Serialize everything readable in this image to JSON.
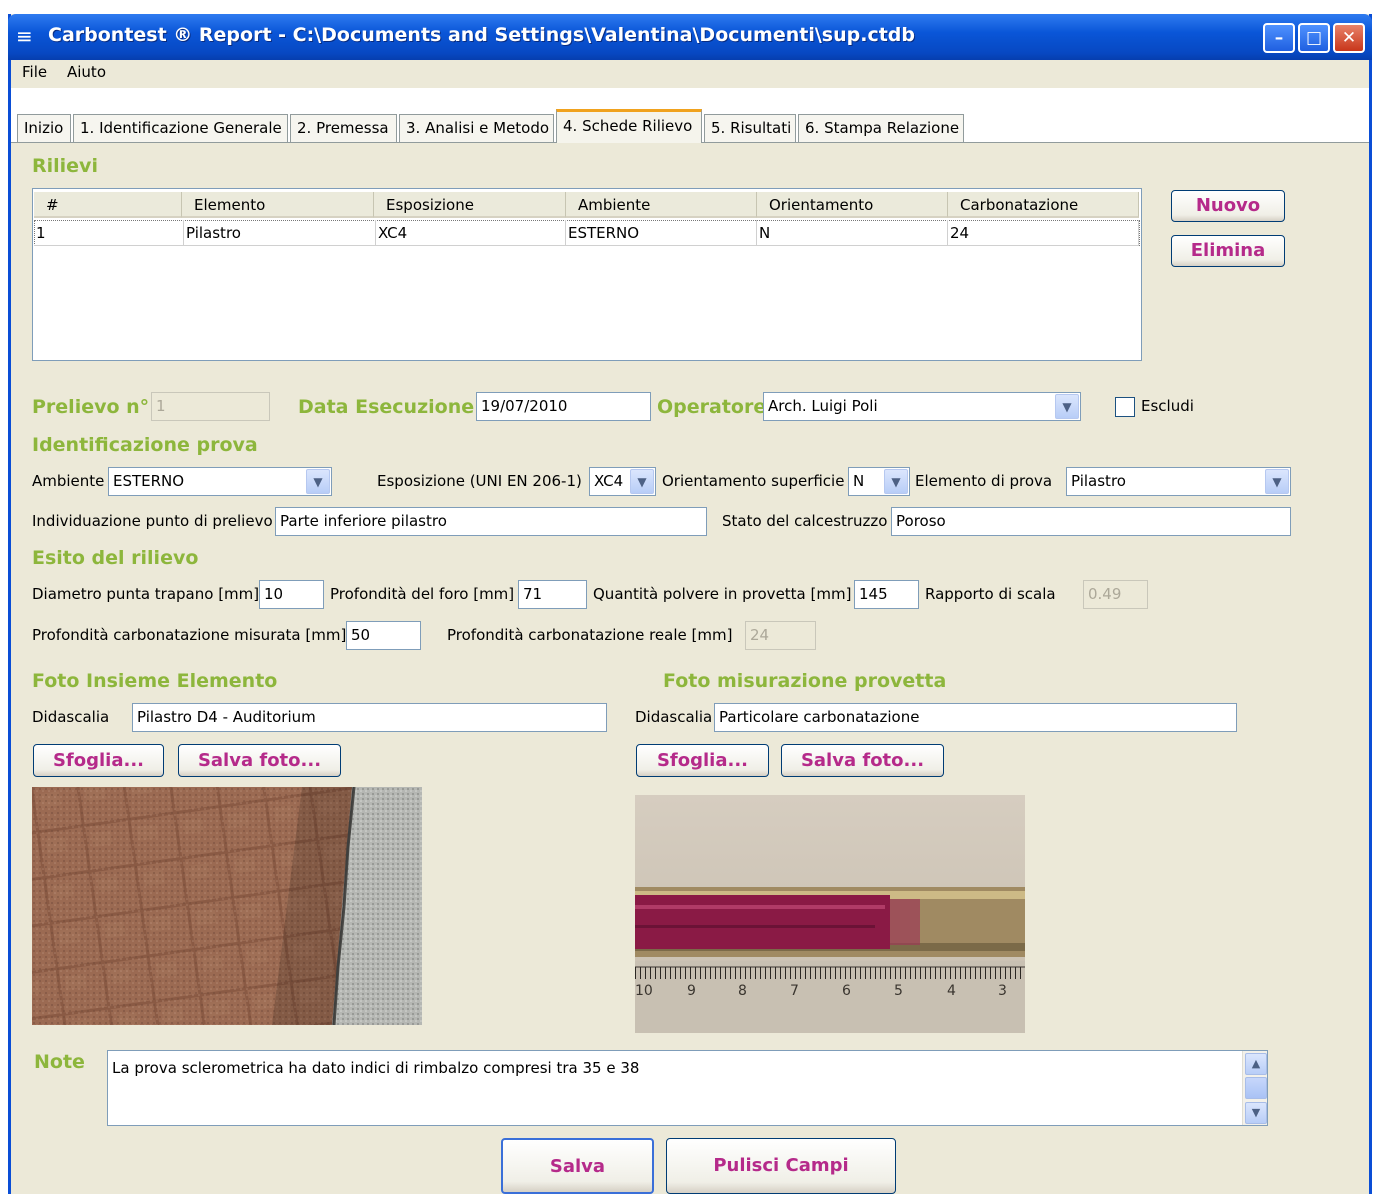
{
  "window": {
    "title": "Carbontest ® Report - C:\\Documents and Settings\\Valentina\\Documenti\\sup.ctdb"
  },
  "menu": [
    "File",
    "Aiuto"
  ],
  "tabs": [
    {
      "label": "Inizio"
    },
    {
      "label": "1. Identificazione Generale"
    },
    {
      "label": "2. Premessa"
    },
    {
      "label": "3. Analisi e Metodo"
    },
    {
      "label": "4. Schede Rilievo",
      "active": true
    },
    {
      "label": "5. Risultati"
    },
    {
      "label": "6. Stampa Relazione"
    }
  ],
  "rilievi": {
    "title": "Rilievi",
    "columns": [
      "#",
      "Elemento",
      "Esposizione",
      "Ambiente",
      "Orientamento",
      "Carbonatazione"
    ],
    "rows": [
      [
        "1",
        "Pilastro",
        "XC4",
        "ESTERNO",
        "N",
        "24"
      ]
    ],
    "new_label": "Nuovo",
    "delete_label": "Elimina"
  },
  "header_fields": {
    "prelievo_label": "Prelievo n°",
    "prelievo_value": "1",
    "data_label": "Data Esecuzione",
    "data_value": "19/07/2010",
    "operatore_label": "Operatore",
    "operatore_value": "Arch. Luigi Poli",
    "escludi_label": "Escludi",
    "escludi_checked": false
  },
  "identificazione": {
    "title": "Identificazione prova",
    "ambiente_label": "Ambiente",
    "ambiente_value": "ESTERNO",
    "esposizione_label": "Esposizione (UNI EN 206-1)",
    "esposizione_value": "XC4",
    "orientamento_label": "Orientamento superficie",
    "orientamento_value": "N",
    "elemento_label": "Elemento di prova",
    "elemento_value": "Pilastro",
    "punto_label": "Individuazione punto di prelievo",
    "punto_value": "Parte inferiore pilastro",
    "stato_label": "Stato del calcestruzzo",
    "stato_value": "Poroso"
  },
  "esito": {
    "title": "Esito del rilievo",
    "diametro_label": "Diametro punta trapano [mm]",
    "diametro_value": "10",
    "profondita_foro_label": "Profondità del foro [mm]",
    "profondita_foro_value": "71",
    "quantita_label": "Quantità polvere in provetta [mm]",
    "quantita_value": "145",
    "rapporto_label": "Rapporto di scala",
    "rapporto_value": "0.49",
    "carb_misurata_label": "Profondità carbonatazione misurata [mm]",
    "carb_misurata_value": "50",
    "carb_reale_label": "Profondità carbonatazione reale [mm]",
    "carb_reale_value": "24"
  },
  "foto_insieme": {
    "title": "Foto Insieme Elemento",
    "didascalia_label": "Didascalia",
    "didascalia_value": "Pilastro D4 - Auditorium",
    "sfoglia_label": "Sfoglia...",
    "salva_label": "Salva foto..."
  },
  "foto_misurazione": {
    "title": "Foto misurazione provetta",
    "didascalia_label": "Didascalia",
    "didascalia_value": "Particolare carbonatazione",
    "sfoglia_label": "Sfoglia...",
    "salva_label": "Salva foto...",
    "ruler_numbers": [
      "10",
      "9",
      "8",
      "7",
      "6",
      "5",
      "4",
      "3"
    ]
  },
  "note": {
    "label": "Note",
    "value": "La prova sclerometrica ha dato indici di rimbalzo compresi tra 35 e 38"
  },
  "footer": {
    "salva_label": "Salva",
    "pulisci_label": "Pulisci Campi"
  },
  "colors": {
    "section_green": "#8db63c",
    "button_text_magenta": "#b52a8a",
    "xp_blue": "#0a56d8",
    "window_bg": "#ece9d8"
  },
  "icons": {
    "app": "menu-icon",
    "minimize": "minimize-icon",
    "maximize": "maximize-icon",
    "close": "close-icon",
    "dropdown": "chevron-down-icon"
  }
}
